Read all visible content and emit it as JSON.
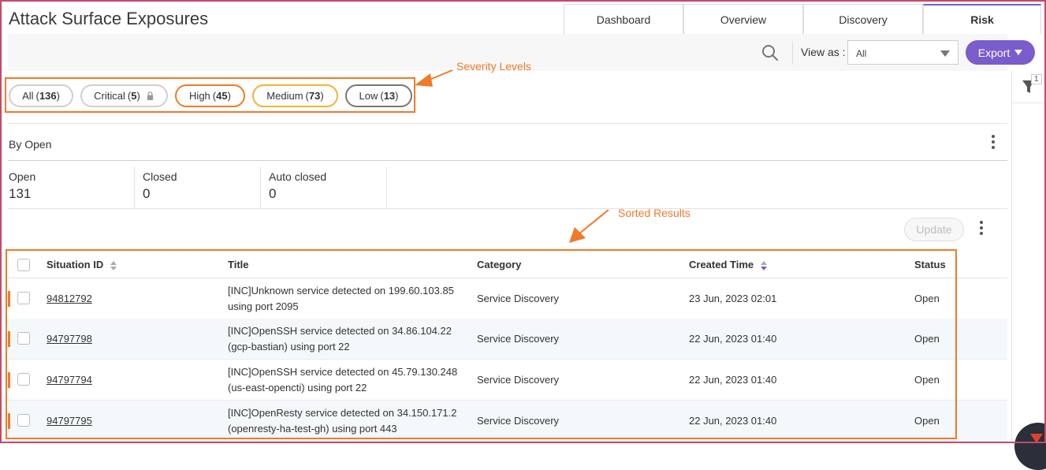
{
  "page": {
    "title": "Attack Surface Exposures"
  },
  "tabs": [
    {
      "label": "Dashboard",
      "active": false
    },
    {
      "label": "Overview",
      "active": false
    },
    {
      "label": "Discovery",
      "active": false
    },
    {
      "label": "Risk",
      "active": true
    }
  ],
  "toolbar": {
    "view_as_label": "View as :",
    "view_as_value": "All",
    "export_label": "Export",
    "accent_color": "#7a5ccc"
  },
  "filter_rail": {
    "badge_count": "1"
  },
  "severity": {
    "all": {
      "name": "All",
      "count": "136"
    },
    "critical": {
      "name": "Critical",
      "count": "5"
    },
    "high": {
      "name": "High",
      "count": "45",
      "color": "#f07a2a"
    },
    "medium": {
      "name": "Medium",
      "count": "73",
      "color": "#f1b23a"
    },
    "low": {
      "name": "Low",
      "count": "13",
      "color": "#777777"
    }
  },
  "annotations": {
    "severity_levels": "Severity Levels",
    "sorted_results": "Sorted Results",
    "color": "#f07a2a"
  },
  "group": {
    "by_label": "By Open"
  },
  "stats": [
    {
      "label": "Open",
      "value": "131"
    },
    {
      "label": "Closed",
      "value": "0"
    },
    {
      "label": "Auto closed",
      "value": "0"
    }
  ],
  "actions": {
    "update_label": "Update"
  },
  "table": {
    "columns": {
      "situation_id": "Situation ID",
      "title": "Title",
      "category": "Category",
      "created_time": "Created Time",
      "status": "Status"
    },
    "rows": [
      {
        "id": "94812792",
        "title": "[INC]Unknown service detected on 199.60.103.85 using port 2095",
        "category": "Service Discovery",
        "created": "23 Jun, 2023 02:01",
        "status": "Open"
      },
      {
        "id": "94797798",
        "title": "[INC]OpenSSH service detected on 34.86.104.22 (gcp-bastian) using port 22",
        "category": "Service Discovery",
        "created": "22 Jun, 2023 01:40",
        "status": "Open"
      },
      {
        "id": "94797794",
        "title": "[INC]OpenSSH service detected on 45.79.130.248 (us-east-opencti) using port 22",
        "category": "Service Discovery",
        "created": "22 Jun, 2023 01:40",
        "status": "Open"
      },
      {
        "id": "94797795",
        "title": "[INC]OpenResty service detected on 34.150.171.2 (openresty-ha-test-gh) using port 443",
        "category": "Service Discovery",
        "created": "22 Jun, 2023 01:40",
        "status": "Open"
      }
    ]
  }
}
